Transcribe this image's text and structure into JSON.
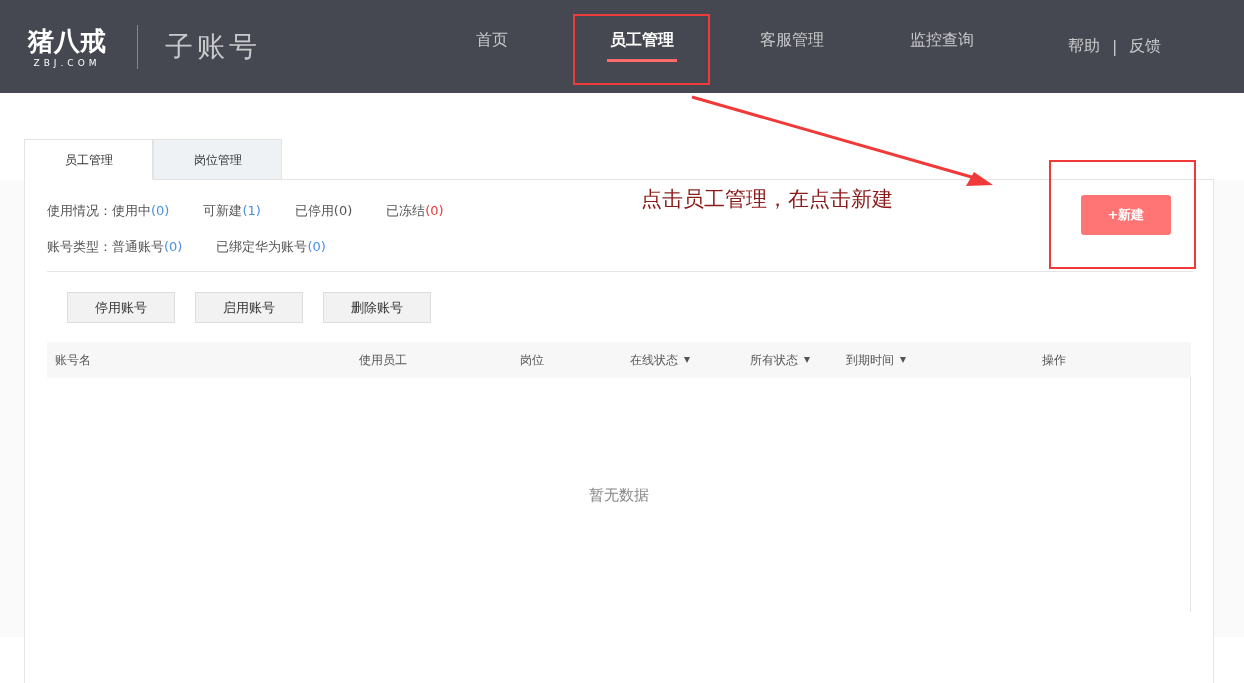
{
  "header": {
    "logo": {
      "name": "猪八戒",
      "domain": "ZBJ.COM"
    },
    "title": "子账号",
    "nav": [
      {
        "label": "首页",
        "selected": false
      },
      {
        "label": "员工管理",
        "selected": true
      },
      {
        "label": "客服管理",
        "selected": false
      },
      {
        "label": "监控查询",
        "selected": false
      }
    ],
    "links": [
      "帮助",
      "反馈"
    ],
    "link_separator": "|"
  },
  "tabs": [
    {
      "label": "员工管理",
      "selected": true
    },
    {
      "label": "岗位管理",
      "selected": false
    }
  ],
  "usage": {
    "label": "使用情况：",
    "items": [
      {
        "text": "使用中",
        "count": "(0)",
        "color": "#4a90e2"
      },
      {
        "text": "可新建",
        "count": "(1)",
        "color": "#4a90e2"
      },
      {
        "text": "已停用",
        "count": "(0)",
        "color": "#555555"
      },
      {
        "text": "已冻结",
        "count": "(0)",
        "color": "#e4393c"
      }
    ]
  },
  "account_types": {
    "label": "账号类型：",
    "items": [
      {
        "text": "普通账号",
        "count": "(0)",
        "color": "#4a90e2"
      },
      {
        "text": "已绑定华为账号",
        "count": "(0)",
        "color": "#4a90e2"
      }
    ]
  },
  "new_button": "+新建",
  "actions": [
    "停用账号",
    "启用账号",
    "删除账号"
  ],
  "table": {
    "columns": [
      {
        "label": "账号名",
        "dropdown": false
      },
      {
        "label": "使用员工",
        "dropdown": false
      },
      {
        "label": "岗位",
        "dropdown": false
      },
      {
        "label": "在线状态",
        "dropdown": true
      },
      {
        "label": "所有状态",
        "dropdown": true
      },
      {
        "label": "到期时间",
        "dropdown": true
      },
      {
        "label": "操作",
        "dropdown": false
      }
    ],
    "empty": "暂无数据"
  },
  "annotation": {
    "text": "点击员工管理，在点击新建"
  }
}
